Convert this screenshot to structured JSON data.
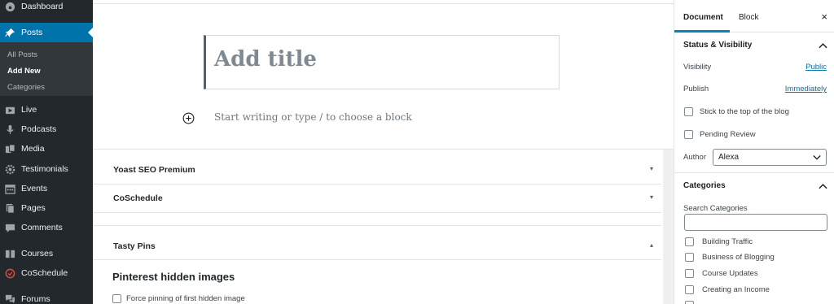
{
  "sidebar": {
    "items": [
      {
        "label": "Dashboard",
        "icon": "dashboard-icon"
      },
      {
        "label": "Posts",
        "icon": "pin-icon"
      },
      {
        "label": "Live",
        "icon": "video-icon"
      },
      {
        "label": "Podcasts",
        "icon": "microphone-icon"
      },
      {
        "label": "Media",
        "icon": "media-icon"
      },
      {
        "label": "Testimonials",
        "icon": "gear-icon"
      },
      {
        "label": "Events",
        "icon": "calendar-icon"
      },
      {
        "label": "Pages",
        "icon": "page-icon"
      },
      {
        "label": "Comments",
        "icon": "comment-icon"
      },
      {
        "label": "Courses",
        "icon": "courses-icon"
      },
      {
        "label": "CoSchedule",
        "icon": "coschedule-icon"
      },
      {
        "label": "Forums",
        "icon": "forums-icon"
      }
    ],
    "submenu": [
      "All Posts",
      "Add New",
      "Categories"
    ],
    "colors": {
      "background": "#23282d",
      "current": "#0073aa",
      "submenu_bg": "#32373c"
    }
  },
  "editor": {
    "title_placeholder": "Add title",
    "block_placeholder": "Start writing or type / to choose a block",
    "add_block_icon": "plus-circle-icon"
  },
  "meta_boxes": {
    "yoast": "Yoast SEO Premium",
    "coschedule": "CoSchedule",
    "tasty_pins": "Tasty Pins",
    "collapsed_icon": "▾",
    "expanded_icon": "▴",
    "pinterest_heading": "Pinterest hidden images",
    "force_pin_label": "Force pinning of first hidden image"
  },
  "settings": {
    "tabs": [
      "Document",
      "Block"
    ],
    "close_icon": "×",
    "status_visibility": {
      "heading": "Status & Visibility",
      "visibility_label": "Visibility",
      "visibility_value": "Public",
      "publish_label": "Publish",
      "publish_value": "Immediately",
      "sticky_label": "Stick to the top of the blog",
      "pending_label": "Pending Review",
      "author_label": "Author",
      "author_value": "Alexa"
    },
    "categories": {
      "heading": "Categories",
      "search_label": "Search Categories",
      "items": [
        "Building Traffic",
        "Business of Blogging",
        "Course Updates",
        "Creating an Income"
      ]
    },
    "colors": {
      "link": "#0073aa",
      "tab_accent": "#0085ba"
    }
  }
}
